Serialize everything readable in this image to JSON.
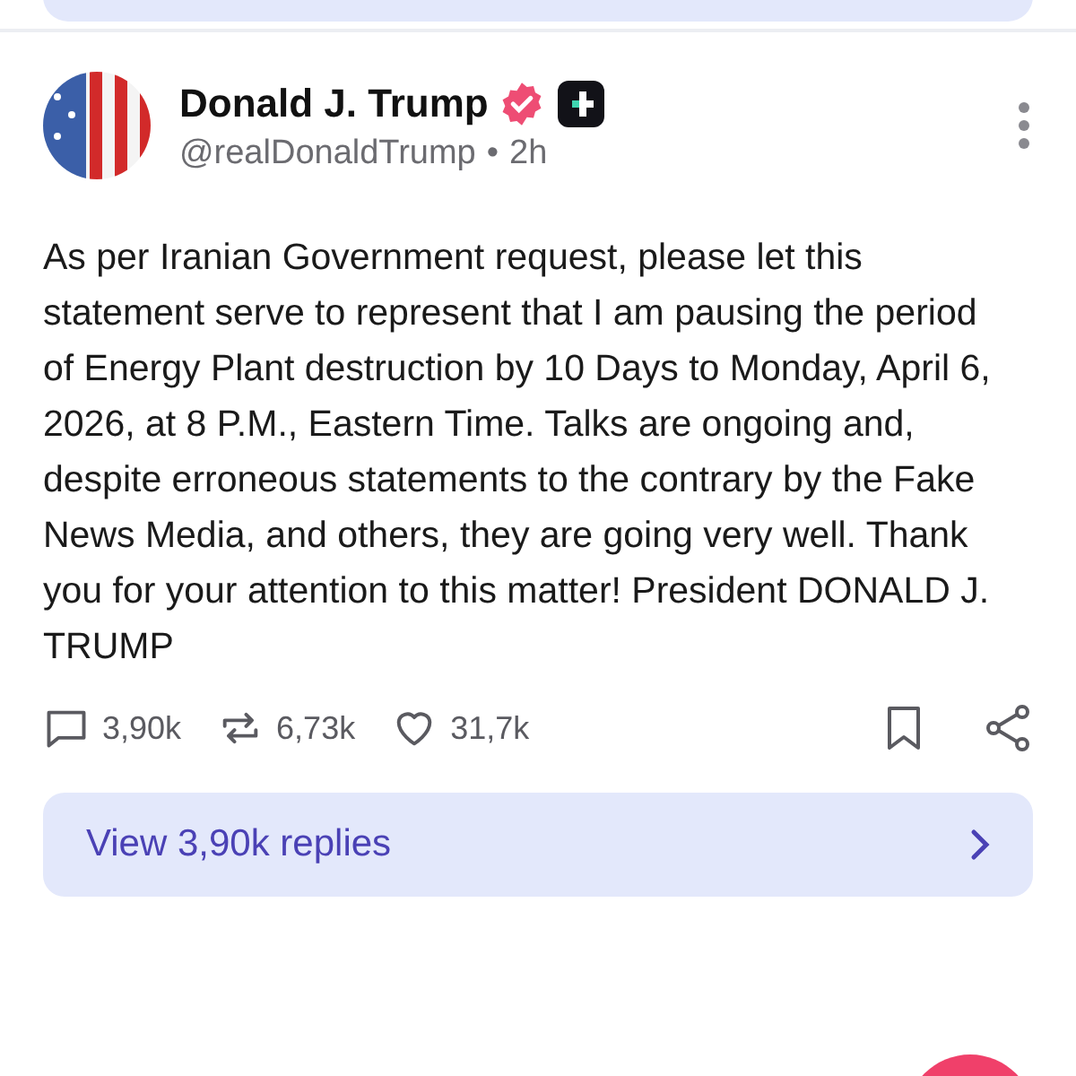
{
  "post": {
    "author": "Donald J. Trump",
    "handle": "@realDonaldTrump",
    "separator": "•",
    "time": "2h",
    "text": "As per Iranian Government request, please let this statement serve to represent that I am pausing the period of Energy Plant destruction by 10 Days to Monday, April 6, 2026, at 8 P.M., Eastern Time. Talks are ongoing and, despite erroneous statements to the contrary by the Fake News Media, and others, they are going very well. Thank you for your attention to this matter! President DONALD J. TRUMP",
    "verified": true
  },
  "actions": [
    {
      "kind": "reply",
      "count": "3,90k"
    },
    {
      "kind": "repost",
      "count": "6,73k"
    },
    {
      "kind": "like",
      "count": "31,7k"
    }
  ],
  "replies_button": {
    "label": "View 3,90k replies"
  }
}
